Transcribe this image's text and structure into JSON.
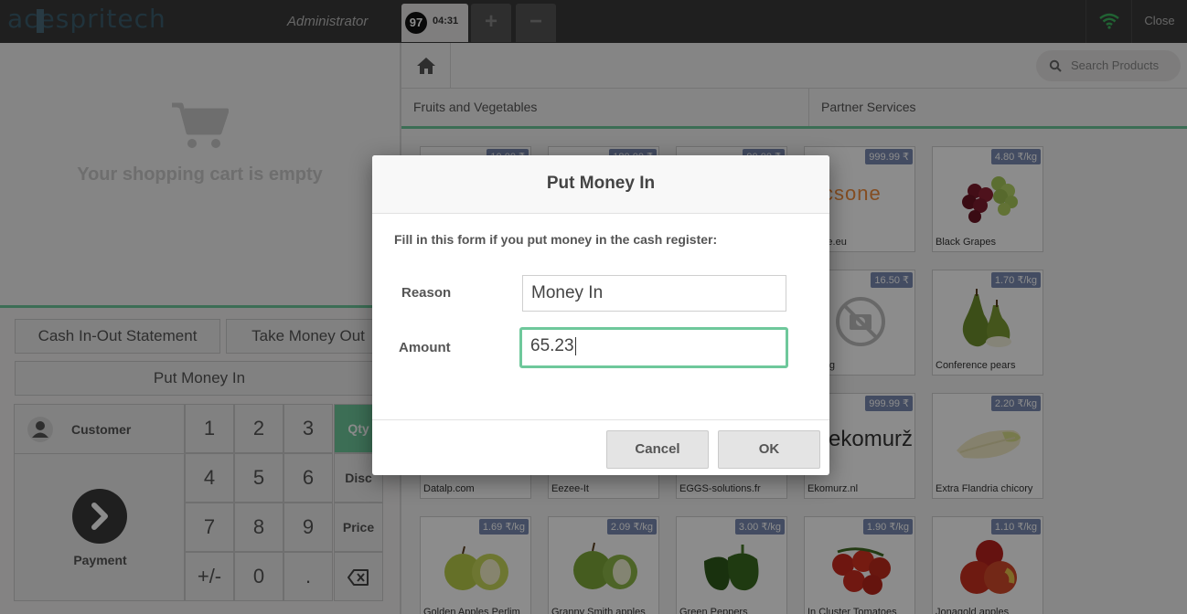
{
  "header": {
    "logo": "acespritech",
    "user": "Administrator",
    "order_badge": "97",
    "order_time": "04:31",
    "add_order_icon": "+",
    "remove_order_icon": "−",
    "close_label": "Close"
  },
  "cart": {
    "empty_text": "Your shopping cart is empty"
  },
  "controls": {
    "cash_statement": "Cash In-Out Statement",
    "take_money_out": "Take Money Out",
    "put_money_in": "Put Money In"
  },
  "numpad": {
    "customer": "Customer",
    "payment": "Payment",
    "keys": [
      "1",
      "2",
      "3",
      "4",
      "5",
      "6",
      "7",
      "8",
      "9",
      "+/-",
      "0",
      "."
    ],
    "modes": [
      "Qty",
      "Disc",
      "Price"
    ],
    "backspace": "⌫"
  },
  "products_pane": {
    "search_placeholder": "Search Products",
    "categories": [
      "Fruits and Vegetables",
      "Partner Services"
    ],
    "items": [
      {
        "name": "",
        "price": "10.00 ₹"
      },
      {
        "name": "",
        "price": "180.00 ₹"
      },
      {
        "name": "",
        "price": "90.00 ₹"
      },
      {
        "name": "...one.eu",
        "price": "999.99 ₹"
      },
      {
        "name": "Black Grapes",
        "price": "4.80 ₹/kg"
      },
      {
        "name": "...ning",
        "price": "16.50 ₹"
      },
      {
        "name": "Conference pears",
        "price": "1.70 ₹/kg"
      },
      {
        "name": "Datalp.com",
        "price": ""
      },
      {
        "name": "Eezee-It",
        "price": ""
      },
      {
        "name": "EGGS-solutions.fr",
        "price": ""
      },
      {
        "name": "Ekomurz.nl",
        "price": "999.99 ₹"
      },
      {
        "name": "Extra Flandria chicory",
        "price": "2.20 ₹/kg"
      },
      {
        "name": "Golden Apples Perlim",
        "price": "1.69 ₹/kg"
      },
      {
        "name": "Granny Smith apples",
        "price": "2.09 ₹/kg"
      },
      {
        "name": "Green Peppers",
        "price": "3.00 ₹/kg"
      },
      {
        "name": "In Cluster Tomatoes",
        "price": "1.90 ₹/kg"
      },
      {
        "name": "Jonagold apples",
        "price": "1.10 ₹/kg"
      }
    ],
    "logo_texts": {
      "csone": "csone",
      "ekomurz": "ekomurž"
    }
  },
  "dialog": {
    "title": "Put Money In",
    "description": "Fill in this form if you put money in the cash register:",
    "reason_label": "Reason",
    "reason_value": "Money In",
    "amount_label": "Amount",
    "amount_value": "65.23",
    "cancel": "Cancel",
    "ok": "OK"
  },
  "colors": {
    "accent": "#6ec89b",
    "price_badge": "#7b8bb3",
    "topbar": "#393939"
  }
}
